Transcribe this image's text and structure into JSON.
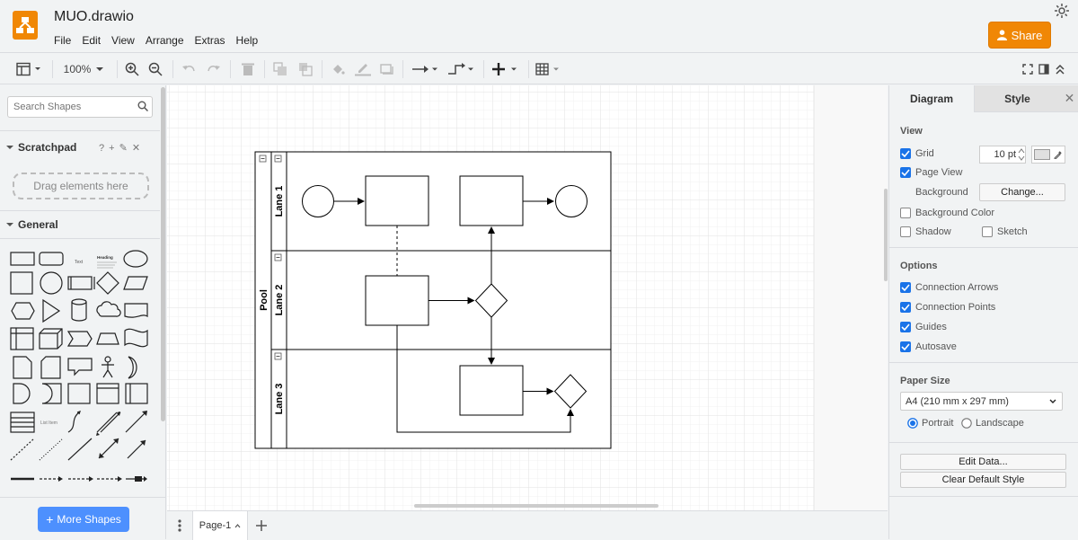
{
  "app": {
    "title": "MUO.drawio",
    "share_label": "Share"
  },
  "menu": [
    "File",
    "Edit",
    "View",
    "Arrange",
    "Extras",
    "Help"
  ],
  "toolbar": {
    "zoom": "100%"
  },
  "sidebar": {
    "search_placeholder": "Search Shapes",
    "scratchpad": "Scratchpad",
    "scratchpad_actions": "? + ✎ ✕",
    "drag_hint": "Drag elements here",
    "general": "General",
    "more_shapes": "More Shapes",
    "shape_text": "Text",
    "shape_heading": "Heading",
    "shape_list_item": "List Item"
  },
  "diagram": {
    "pool": "Pool",
    "lanes": [
      "Lane 1",
      "Lane 2",
      "Lane 3"
    ]
  },
  "pages": {
    "current": "Page-1"
  },
  "format": {
    "tabs": [
      "Diagram",
      "Style"
    ],
    "view_title": "View",
    "grid_label": "Grid",
    "grid_size": "10 pt",
    "page_view": "Page View",
    "background_label": "Background",
    "change_button": "Change...",
    "background_color": "Background Color",
    "shadow": "Shadow",
    "sketch": "Sketch",
    "options_title": "Options",
    "options": [
      "Connection Arrows",
      "Connection Points",
      "Guides",
      "Autosave"
    ],
    "paper_size_title": "Paper Size",
    "paper_size": "A4 (210 mm x 297 mm)",
    "portrait": "Portrait",
    "landscape": "Landscape",
    "edit_data": "Edit Data...",
    "clear_default_style": "Clear Default Style"
  },
  "colors": {
    "accent": "#f08705",
    "blue": "#1a73e8",
    "more_shapes": "#4d90fe"
  }
}
